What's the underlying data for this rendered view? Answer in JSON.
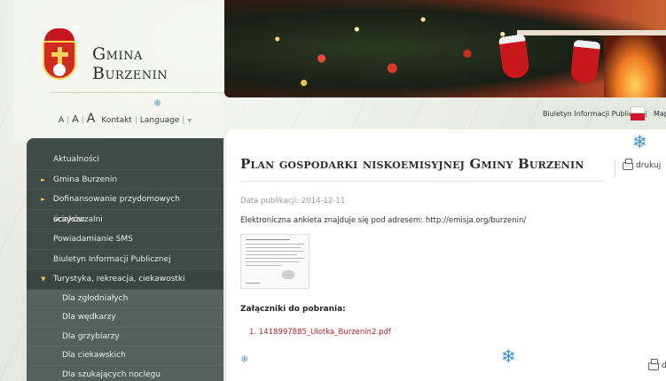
{
  "brand": {
    "name": "Gmina Burzenin"
  },
  "utility": {
    "font_small": "A",
    "font_medium": "A",
    "font_large": "A",
    "contact": "Kontakt",
    "language": "Language",
    "language_arrow": "▼"
  },
  "header_links": {
    "bip": "Biuletyn Informacji Publicznej",
    "map": "Map"
  },
  "sidebar": {
    "items": [
      {
        "label": "Aktualności",
        "arrow": ""
      },
      {
        "label": "Gmina Burzenin",
        "arrow": "►"
      },
      {
        "label": "Dofinansowanie przydomowych oczyszczalni",
        "arrow": "►"
      },
      {
        "label": "ścieków",
        "arrow": ""
      },
      {
        "label": "Powiadamianie SMS",
        "arrow": ""
      },
      {
        "label": "Biuletyn Informacji Publicznej",
        "arrow": ""
      },
      {
        "label": "Turystyka, rekreacja, ciekawostki",
        "arrow": "▼"
      }
    ],
    "subitems": [
      {
        "label": "Dla zgłodniałych"
      },
      {
        "label": "Dla wędkarzy"
      },
      {
        "label": "Dla grzybiarzy"
      },
      {
        "label": "Dla ciekawskich"
      },
      {
        "label": "Dla szukających noclegu"
      }
    ]
  },
  "article": {
    "title": "Plan gospodarki niskoemisyjnej Gminy Burzenin",
    "print_label": "drukuj",
    "pubdate": "Data publikacji: 2014-12-11",
    "intro": "Elektroniczna ankieta znajduje się pod adresem: http://emisja.org/burzenin/",
    "attachments_title": "Załączniki do pobrania:",
    "attachments": [
      {
        "label": "1. 1418997885_Ulotka_Burzenin2.pdf"
      }
    ],
    "print_label_bottom": "drukuj"
  },
  "snowflake": "❄",
  "colors": {
    "sidebar_bg": "#3f4b47",
    "submenu_bg": "#55615c",
    "arrow": "#f1c24b",
    "link": "#b5232c",
    "snow": "#3d8fd4"
  }
}
